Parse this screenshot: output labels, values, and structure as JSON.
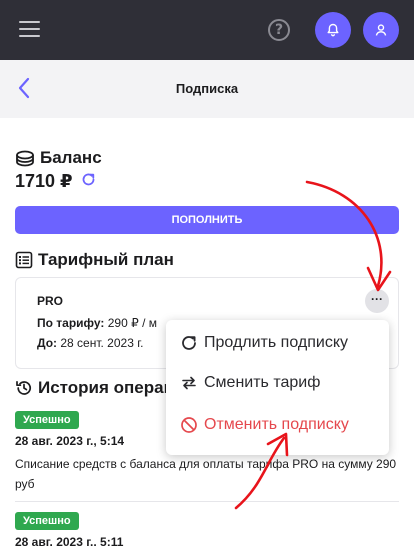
{
  "header": {
    "title": "Подписка"
  },
  "balance": {
    "title": "Баланс",
    "amount": "1710 ₽",
    "topup_label": "ПОПОЛНИТЬ"
  },
  "tariff": {
    "title": "Тарифный план",
    "plan_name": "PRO",
    "price_label": "По тарифу:",
    "price_value": " 290 ₽ / м",
    "until_label": "До:",
    "until_value": " 28 сент. 2023 г.",
    "more_label": "···"
  },
  "menu": {
    "items": [
      {
        "label": "Продлить подписку",
        "icon": "refresh-icon"
      },
      {
        "label": "Сменить тариф",
        "icon": "swap-icon"
      },
      {
        "label": "Отменить подписку",
        "icon": "cancel-icon"
      }
    ]
  },
  "history": {
    "title": "История операций",
    "entries": [
      {
        "status": "Успешно",
        "date": "28 авг. 2023 г., 5:14",
        "description": "Списание средств с баланса для оплаты тарифа PRO на сумму 290 руб"
      },
      {
        "status": "Успешно",
        "date": "28 авг. 2023 г., 5:11"
      }
    ]
  },
  "colors": {
    "accent": "#6c63ff",
    "topbar": "#2f2f37",
    "success": "#2fa84f",
    "danger": "#e5484d",
    "annotation": "#e8141b"
  }
}
